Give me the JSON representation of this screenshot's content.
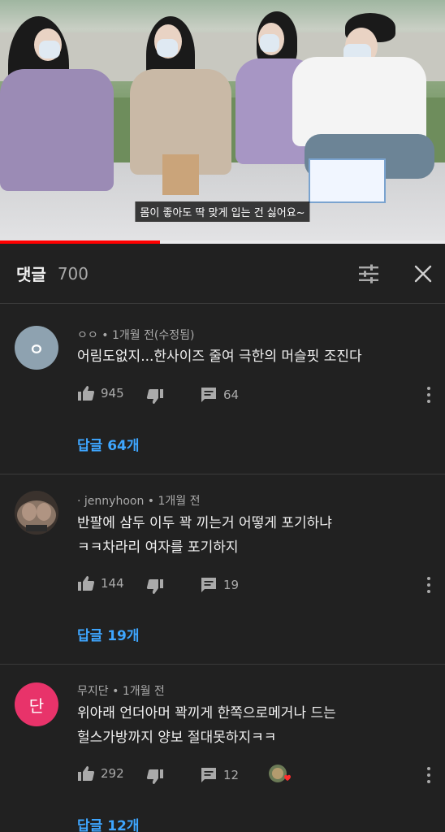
{
  "video": {
    "subtitle": "몸이 좋아도 딱 맞게 입는 건 싫어요~",
    "progress": 0.36
  },
  "header": {
    "title": "댓글",
    "count": "700"
  },
  "comments": [
    {
      "avatar_letter": "ㅇ",
      "avatar_color": "#8ea2b0",
      "author": "ㅇㅇ",
      "time": "1개월 전(수정됨)",
      "lines": [
        "어림도없지...한사이즈 줄여 극한의 머슬핏 조진다"
      ],
      "likes": "945",
      "reply_count": "64",
      "replies_label": "답글 64개"
    },
    {
      "avatar_letter": "",
      "avatar_color": "#8a7566",
      "author": "jennyhoon",
      "time": "1개월 전",
      "lines": [
        "반팔에 삼두 이두 꽉 끼는거 어떻게 포기하냐",
        "ㅋㅋ차라리 여자를 포기하지"
      ],
      "likes": "144",
      "reply_count": "19",
      "replies_label": "답글 19개"
    },
    {
      "avatar_letter": "단",
      "avatar_color": "#e8336a",
      "author": "무지단",
      "time": "1개월 전",
      "lines": [
        "위아래 언더아머  꽉끼게 한쪽으로메거나 드는",
        "헐스가방까지 양보 절대못하지ㅋㅋ"
      ],
      "likes": "292",
      "reply_count": "12",
      "replies_label": "답글 12개"
    }
  ],
  "colors": {
    "background": "#212121",
    "text": "#f1f1f1",
    "secondary": "#aaaaaa",
    "link": "#3ea6ff",
    "divider": "#3a3a3a"
  }
}
